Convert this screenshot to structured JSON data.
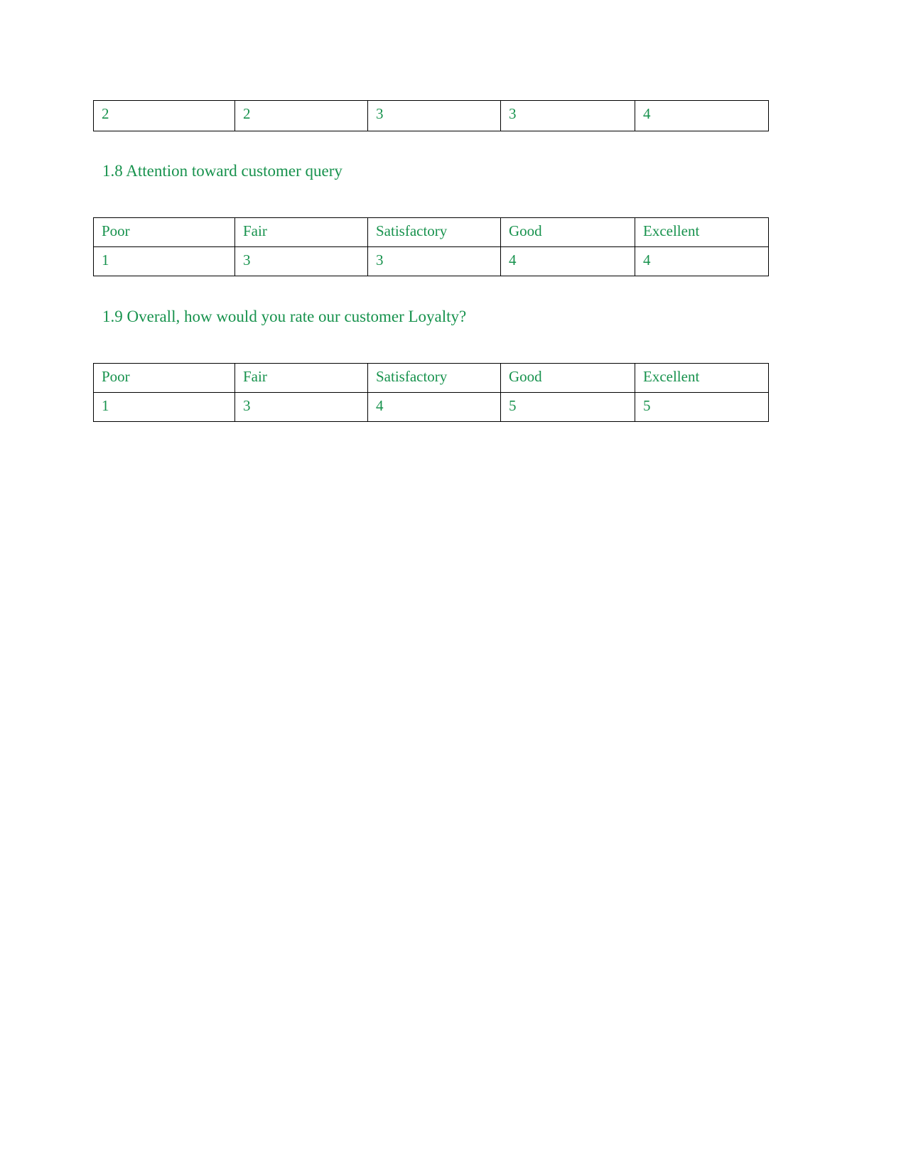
{
  "document": {
    "text_color": "#17924d",
    "border_color": "#000000",
    "background": "#ffffff"
  },
  "top_table": {
    "name": "continued-ratings-row",
    "rows": [
      [
        "2",
        "2",
        "3",
        "3",
        "4"
      ]
    ]
  },
  "sections": [
    {
      "heading": "1.8 Attention toward customer query",
      "table": {
        "headers": [
          "Poor",
          "Fair",
          "Satisfactory",
          "Good",
          "Excellent"
        ],
        "values": [
          "1",
          "3",
          "3",
          "4",
          "4"
        ]
      }
    },
    {
      "heading": "1.9 Overall, how would you rate our customer Loyalty?",
      "table": {
        "headers": [
          "Poor",
          "Fair",
          "Satisfactory",
          "Good",
          "Excellent"
        ],
        "values": [
          "1",
          "3",
          "4",
          "5",
          "5"
        ]
      }
    }
  ]
}
